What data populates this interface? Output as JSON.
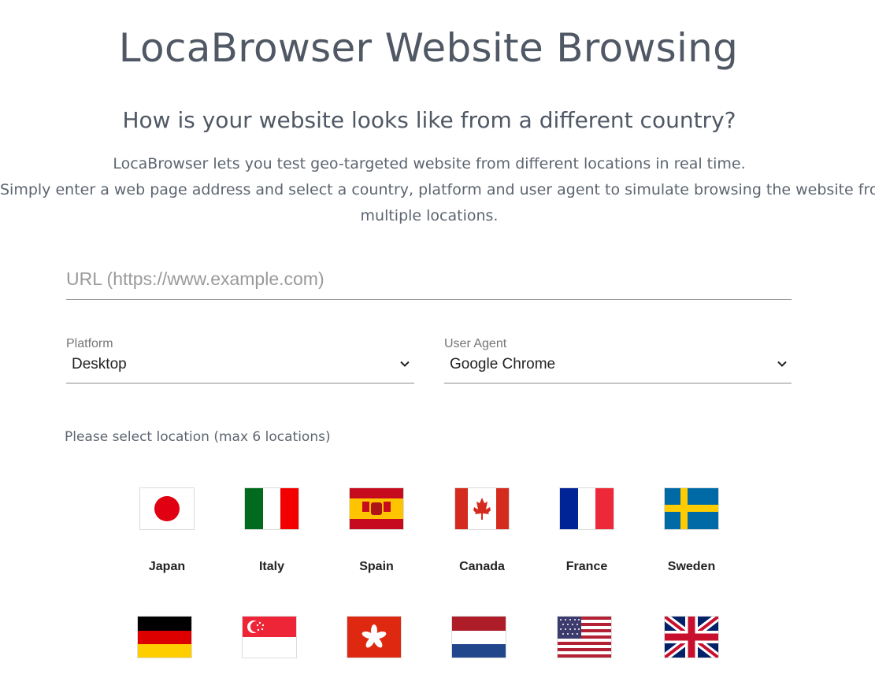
{
  "page": {
    "title": "LocaBrowser Website Browsing",
    "subtitle": "How is your website looks like from a different country?",
    "desc_line1": "LocaBrowser lets you test geo-targeted website from different locations in real time.",
    "desc_line2": "Simply enter a web page address and select a country, platform and user agent to simulate browsing the website from",
    "desc_line3": "multiple locations."
  },
  "form": {
    "url_placeholder": "URL (https://www.example.com)",
    "platform": {
      "label": "Platform",
      "value": "Desktop"
    },
    "user_agent": {
      "label": "User Agent",
      "value": "Google Chrome"
    },
    "location_label": "Please select location (max 6 locations)"
  },
  "locations": {
    "row1": [
      "Japan",
      "Italy",
      "Spain",
      "Canada",
      "France",
      "Sweden"
    ]
  },
  "icons": {
    "dropdown": "chevron-down-icon"
  }
}
